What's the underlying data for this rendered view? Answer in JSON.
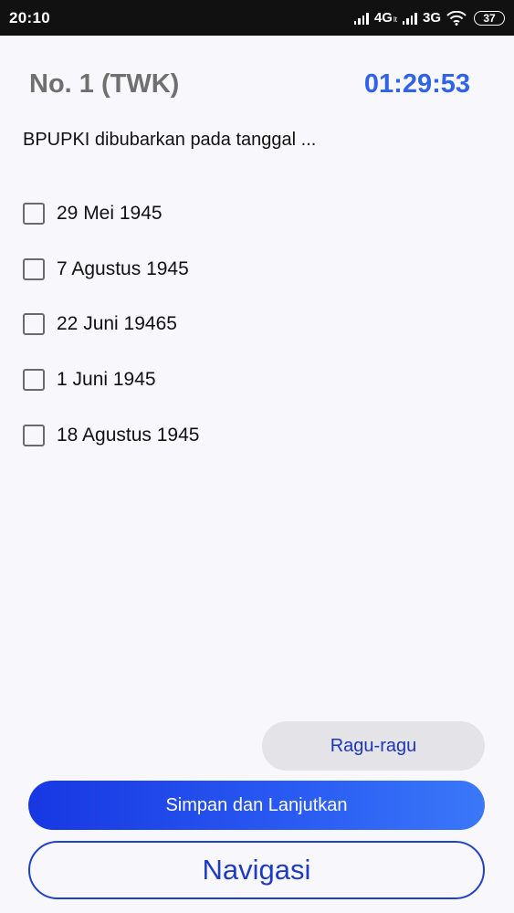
{
  "status_bar": {
    "time": "20:10",
    "network_1": "4G",
    "network_1_sub": "lt",
    "network_2": "3G",
    "battery": "37"
  },
  "header": {
    "question_number": "No. 1 (TWK)",
    "timer": "01:29:53"
  },
  "question": {
    "text": "BPUPKI dibubarkan pada tanggal ...",
    "options": [
      {
        "label": "29 Mei 1945",
        "checked": false
      },
      {
        "label": "7 Agustus 1945",
        "checked": false
      },
      {
        "label": "22 Juni 19465",
        "checked": false
      },
      {
        "label": "1 Juni 1945",
        "checked": false
      },
      {
        "label": "18 Agustus 1945",
        "checked": false
      }
    ]
  },
  "buttons": {
    "doubt": "Ragu-ragu",
    "save_next": "Simpan dan Lanjutkan",
    "navigation": "Navigasi"
  },
  "colors": {
    "accent_blue": "#2f63e8",
    "button_blue": "#1737e2",
    "status_bar": "#111111"
  },
  "icons": [
    "signal-icon",
    "wifi-icon",
    "battery-icon",
    "checkbox-icon"
  ]
}
